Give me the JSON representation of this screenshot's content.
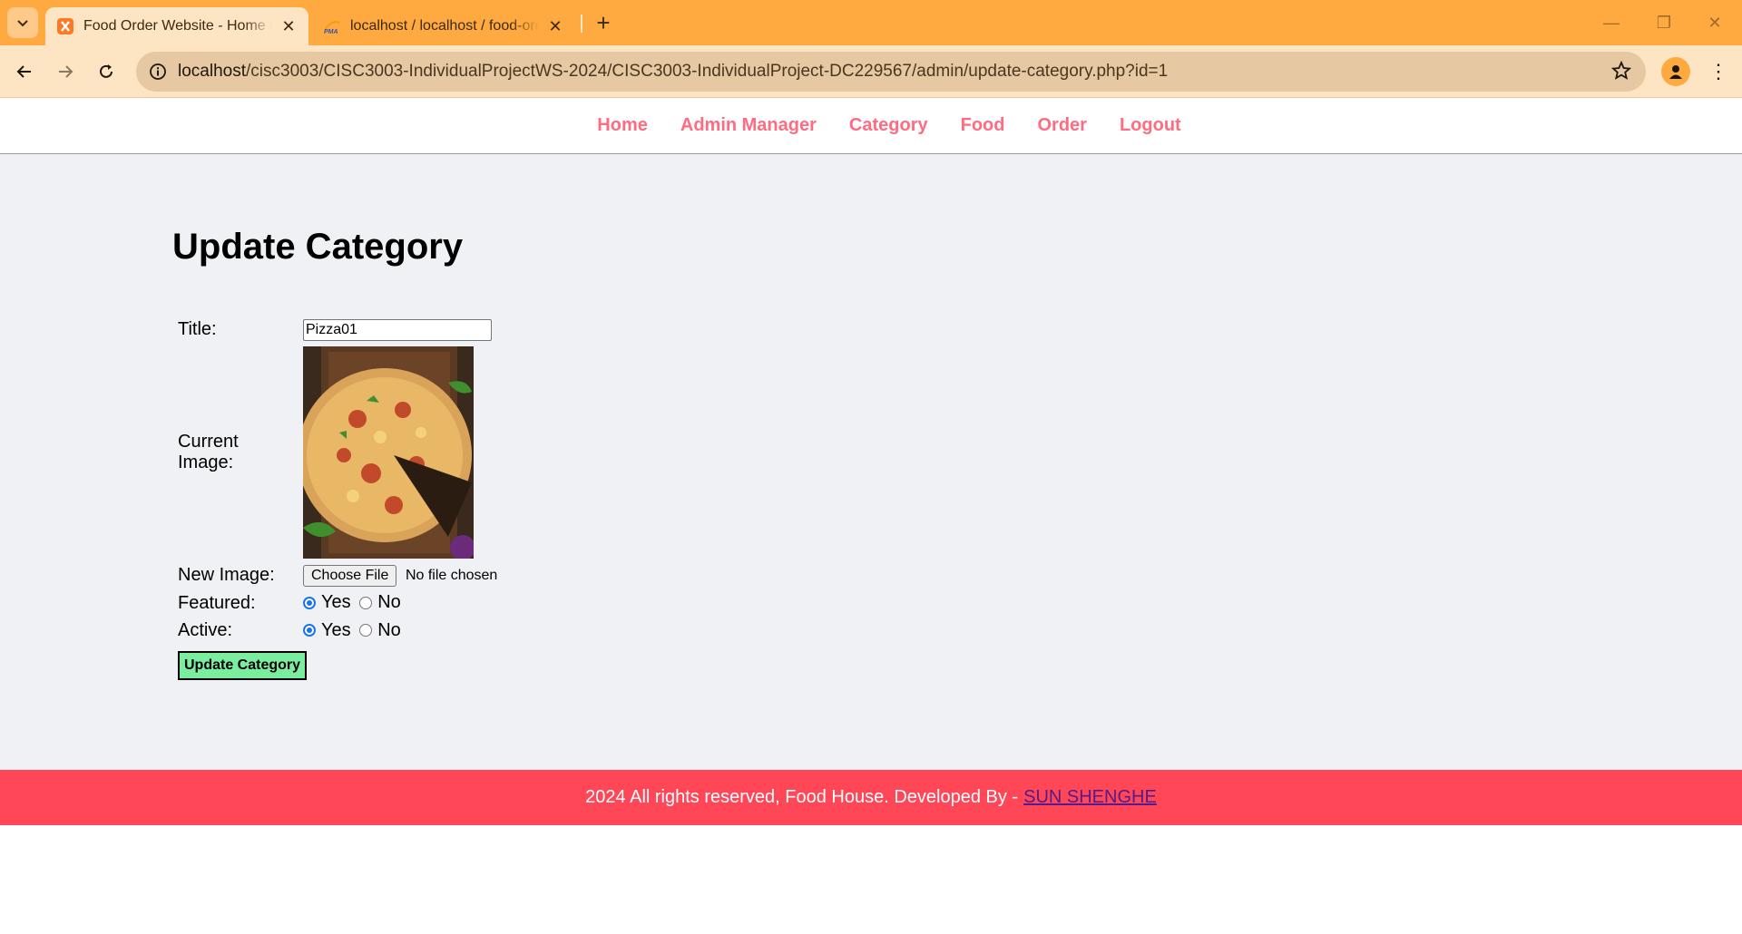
{
  "browser": {
    "tabs": [
      {
        "title": "Food Order Website - Home Page",
        "active": true,
        "icon": "xampp-icon"
      },
      {
        "title": "localhost / localhost / food-order",
        "active": false,
        "icon": "phpmyadmin-icon"
      }
    ],
    "new_tab_label": "+",
    "url_host": "localhost",
    "url_path": "/cisc3003/CISC3003-IndividualProjectWS-2024/CISC3003-IndividualProject-DC229567/admin/update-category.php?id=1",
    "colors": {
      "tabbar": "#ffaa40",
      "toolbar": "#fde5c4"
    }
  },
  "nav": {
    "items": [
      "Home",
      "Admin Manager",
      "Category",
      "Food",
      "Order",
      "Logout"
    ],
    "color": "#ff6b81"
  },
  "page": {
    "heading": "Update Category",
    "form": {
      "title_label": "Title:",
      "title_value": "Pizza01",
      "current_image_label": "Current Image:",
      "new_image_label": "New Image:",
      "choose_file_label": "Choose File",
      "file_status": "No file chosen",
      "featured_label": "Featured:",
      "active_label": "Active:",
      "yes_label": "Yes",
      "no_label": "No",
      "featured_value": "Yes",
      "active_value": "Yes",
      "submit_label": "Update Category"
    }
  },
  "footer": {
    "text": "2024 All rights reserved, Food House. Developed By -",
    "link": "SUN SHENGHE",
    "color": "#ff4757"
  }
}
